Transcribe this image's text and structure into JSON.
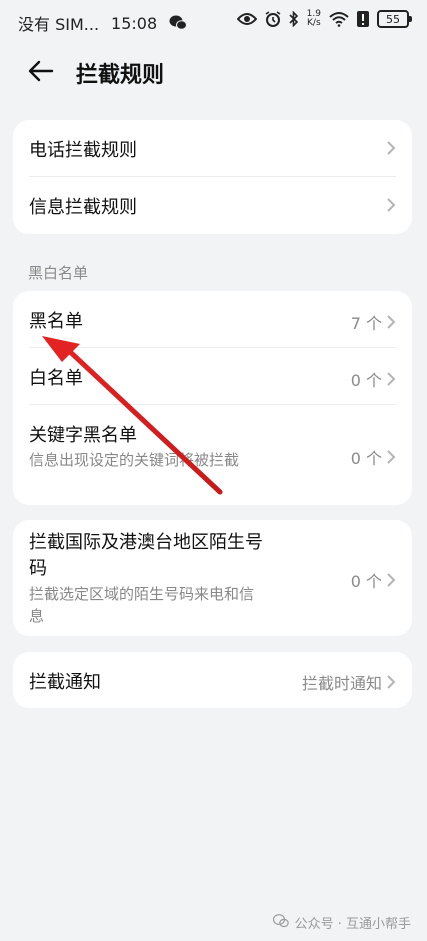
{
  "status_bar": {
    "carrier": "没有 SIM...",
    "time": "15:08",
    "net_speed_top": "1.9",
    "net_speed_bottom": "K/s",
    "battery": "55",
    "colors": {
      "text": "#222222"
    }
  },
  "header": {
    "title": "拦截规则",
    "back_icon": "arrow-left-icon"
  },
  "group1": {
    "items": [
      {
        "label": "电话拦截规则"
      },
      {
        "label": "信息拦截规则"
      }
    ]
  },
  "blackwhite": {
    "section_label": "黑白名单",
    "items": [
      {
        "label": "黑名单",
        "value": "7 个"
      },
      {
        "label": "白名单",
        "value": "0 个"
      },
      {
        "label": "关键字黑名单",
        "subtitle": "信息出现设定的关键词将被拦截",
        "value": "0 个"
      }
    ]
  },
  "international": {
    "label": "拦截国际及港澳台地区陌生号码",
    "subtitle": "拦截选定区域的陌生号码来电和信息",
    "value": "0 个"
  },
  "notify": {
    "label": "拦截通知",
    "value": "拦截时通知"
  },
  "watermark": {
    "text": "公众号 · 互通小帮手"
  },
  "colors": {
    "background": "#f1f3f5",
    "card": "#ffffff",
    "annotation_arrow": "#e32222"
  }
}
